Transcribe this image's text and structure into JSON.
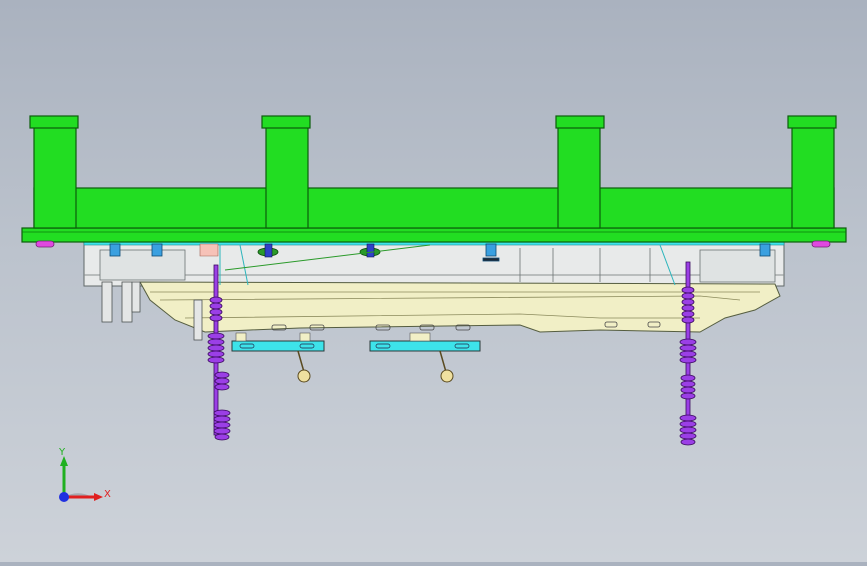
{
  "viewport": {
    "background_top": "#aab2bf",
    "background_bottom": "#cdd2d9"
  },
  "model": {
    "frame_color": "#22dd22",
    "frame_edge_color": "#0b5e0b",
    "plate_color": "#f2f0c8",
    "slider_color": "#33e0e8",
    "spring_color": "#8a2be2",
    "bolt_color": "#3aa0e0"
  },
  "triad": {
    "x_label": "X",
    "y_label": "Y",
    "x_color": "#e02020",
    "y_color": "#20b020",
    "z_color": "#2030e0"
  }
}
